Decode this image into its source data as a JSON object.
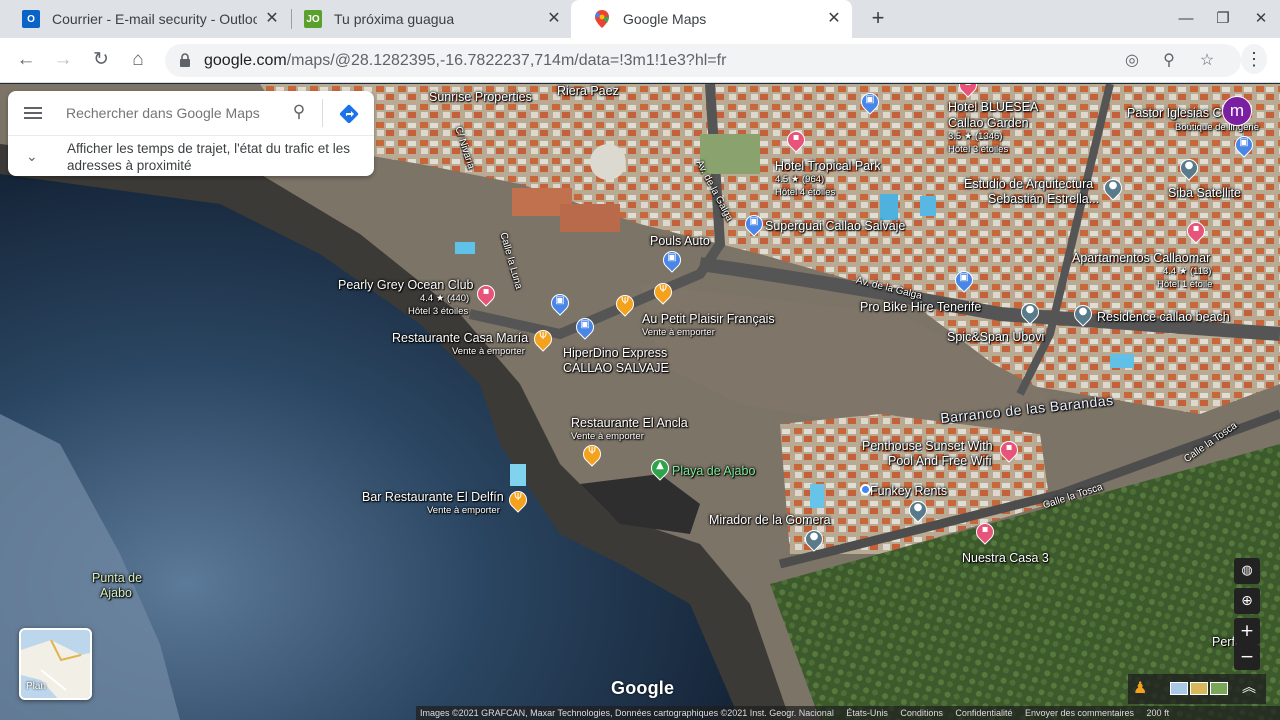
{
  "browser": {
    "tabs": [
      {
        "title": "Courrier - E-mail security - Outloo",
        "favicon": "outlook-icon"
      },
      {
        "title": "Tu próxima guagua",
        "favicon": "guagua-icon"
      },
      {
        "title": "Google Maps",
        "favicon": "maps-icon"
      }
    ],
    "address": {
      "host": "google.com",
      "path": "/maps/@28.1282395,-16.7822237,714m/data=!3m1!1e3?hl=fr"
    }
  },
  "search": {
    "placeholder": "Rechercher dans Google Maps",
    "traffic_text": "Afficher les temps de trajet, l'état du trafic et les adresses à proximité"
  },
  "account": {
    "initial": "m"
  },
  "map": {
    "labels": {
      "sunrise": "Sunrise Properties",
      "riera": "Riera Paez",
      "hotel_bluesea": "Hotel BLUESEA",
      "callao_garden": "Callao Garden",
      "bluesea_rating": "3.5 ★ (1346)",
      "bluesea_stars": "Hôtel 3 étoiles",
      "pastor": "Pastor Iglesias C",
      "lingerie": "Boutique de lingerie",
      "hotel_tropical": "Hotel Tropical Park",
      "tropical_rating": "4.5 ★ (964)",
      "tropical_stars": "Hôtel 4 étoiles",
      "estudio1": "Estudio de Arquitectura",
      "estudio2": "Sebastián Estrella...",
      "siba": "Siba Satellite",
      "supergual": "Superguai Callao Salvaje",
      "pouls": "Pouls Auto",
      "apartamentos": "Apartamentos Callaomar",
      "apart_rating": "4.4 ★ (113)",
      "apart_stars": "Hôtel 1 étoile",
      "pearly": "Pearly Grey Ocean Club",
      "pearly_rating": "4.4 ★ (440)",
      "pearly_stars": "Hôtel 3 étoiles",
      "av_galga": "Av. de la Galga",
      "av_galga2": "Av. de la Galga",
      "c_nivaria": "C/ Nivaria",
      "calle_luna": "Calle la Luna",
      "pro_bike": "Pro Bike Hire Tenerife",
      "residence": "Residence callao beach",
      "casa_maria": "Restaurante Casa María",
      "casa_maria_sub": "Vente à emporter",
      "petit_plaisir": "Au Petit Plaisir Français",
      "petit_plaisir_sub": "Vente à emporter",
      "hiperdino1": "HiperDino Express",
      "hiperdino2": "CALLAO SALVAJE",
      "spic": "Spic&Span Ubovi",
      "barranco": "Barranco de las Barandas",
      "el_ancla": "Restaurante El Ancla",
      "el_ancla_sub": "Vente à emporter",
      "penthouse1": "Penthouse Sunset With",
      "penthouse2": "Pool And Free Wifi",
      "calle_tosca": "Calle la Tosca",
      "calle_tosca2": "Calle la Tosca",
      "playa": "Playa de Ajabo",
      "funkey": "Funkey Rents",
      "el_delfin": "Bar Restaurante El Delfín",
      "el_delfin_sub": "Vente à emporter",
      "mirador": "Mirador de la Gomera",
      "nuestra": "Nuestra Casa 3",
      "punta1": "Punta de",
      "punta2": "Ajabo",
      "perfume": "Perfume"
    },
    "plan_label": "Plan",
    "google_logo": "Google"
  },
  "footer": {
    "attribution": "Images ©2021 GRAFCAN, Maxar Technologies, Données cartographiques ©2021 Inst. Geogr. Nacional",
    "country": "États-Unis",
    "conditions": "Conditions",
    "privacy": "Confidentialité",
    "feedback": "Envoyer des commentaires",
    "scale": "200 ft"
  },
  "colors": {
    "accent": "#1a73e8",
    "avatar": "#7b1fa2"
  }
}
